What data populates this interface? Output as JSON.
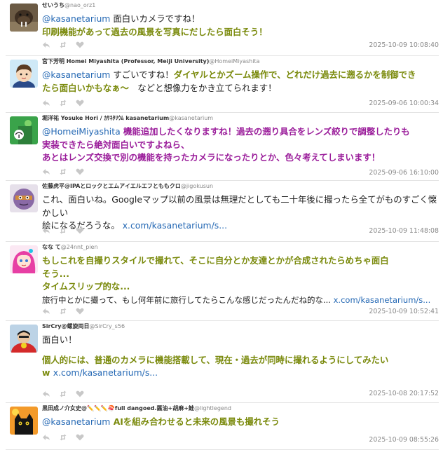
{
  "tweets": [
    {
      "name": "せいうち",
      "handle": "@nao_orz1",
      "lines": [
        [
          {
            "t": "mention",
            "v": "@kasanetarium"
          },
          {
            "t": "text",
            "v": " 面白いカメラですね！"
          }
        ],
        [
          {
            "t": "hl",
            "v": "印刷機能があって過去の風景を写真にだしたら面白そう！"
          }
        ]
      ],
      "timestamp": "2025-10-09 10:08:40"
    },
    {
      "name": "宮下芳明 Homei Miyashita (Professor, Meiji University)",
      "handle": "@HomeiMiyashita",
      "lines": [
        [
          {
            "t": "mention",
            "v": "@kasanetarium"
          },
          {
            "t": "text",
            "v": " すごいですね！"
          },
          {
            "t": "hl",
            "v": "ダイヤルとかズーム操作で、どれだけ過去に遡るかを制御でき"
          }
        ],
        [
          {
            "t": "hl",
            "v": "たら面白いかもなぁ〜"
          },
          {
            "t": "text",
            "v": "　などと想像力をかき立てられます！"
          }
        ]
      ],
      "timestamp": "2025-09-06 10:00:34"
    },
    {
      "name": "堀洋祐 Yosuke Hori / ｶｻﾈﾀﾘｳﾑ kasanetarium",
      "handle": "@kasanetarium",
      "lines": [
        [
          {
            "t": "mention",
            "v": "@HomeiMiyashita"
          },
          {
            "t": "hl2",
            "v": " 機能追加したくなりますね！過去の遡り具合をレンズ絞りで調整したりも"
          }
        ],
        [
          {
            "t": "hl2",
            "v": "実装できたら絶対面白いですよねら、"
          }
        ],
        [
          {
            "t": "hl2",
            "v": "あとはレンズ交換で別の機能を持ったカメラになったりとか、色々考えてしまいます！"
          }
        ]
      ],
      "timestamp": "2025-09-06 16:10:00"
    },
    {
      "name": "佐藤虎平@IPAとロックとエムアイエルエフとももクロ",
      "handle": "@jigokusun",
      "lines": [
        [
          {
            "t": "text",
            "v": "これ、面白いね。Googleマップ以前の風景は無理だとしても二十年後に撮ったら全てがものすごく懐かしい"
          }
        ],
        [
          {
            "t": "text",
            "v": "絵になるだろうな。 "
          },
          {
            "t": "link",
            "v": "x.com/kasanetarium/s..."
          }
        ]
      ],
      "timestamp": "2025-10-09 11:48:08"
    },
    {
      "name": "なな て",
      "handle": "@24nnt_pien",
      "lines": [
        [
          {
            "t": "hl",
            "v": "もしこれを自撮りスタイルで撮れて、そこに自分とか友達とかが合成されたらめちゃ面白"
          }
        ],
        [
          {
            "t": "hl",
            "v": "そう..."
          }
        ],
        [
          {
            "t": "hl",
            "v": "タイムスリップ的な..."
          }
        ],
        [
          {
            "t": "small",
            "v": "旅行中とかに撮って、もし何年前に旅行してたらこんな感じだったんだね的な... "
          },
          {
            "t": "linksmall",
            "v": "x.com/kasanetarium/s..."
          }
        ]
      ],
      "timestamp": "2025-10-09 10:52:41"
    },
    {
      "name": "SirCry@螺旋両日",
      "handle": "@SirCry_s56",
      "lines": [
        [
          {
            "t": "text",
            "v": "面白い！"
          }
        ],
        [
          {
            "t": "blank",
            "v": ""
          }
        ],
        [
          {
            "t": "hl",
            "v": "個人的には、普通のカメラに機能搭載して、現在・過去が同時に撮れるようにしてみたい"
          }
        ],
        [
          {
            "t": "hl",
            "v": "w "
          },
          {
            "t": "link",
            "v": "x.com/kasanetarium/s..."
          }
        ]
      ],
      "timestamp": "2025-10-08 20:17:52"
    },
    {
      "name": "黒田成ノ介女史@✏️✏️✏️🍣full dangoed.醤油+胡麻+鮭",
      "handle": "@lightlegend",
      "lines": [
        [
          {
            "t": "mention",
            "v": "@kasanetarium"
          },
          {
            "t": "hl",
            "v": " AIを組み合わせると未来の風景も撮れそう"
          }
        ]
      ],
      "timestamp": "2025-10-09 08:55:26"
    }
  ]
}
